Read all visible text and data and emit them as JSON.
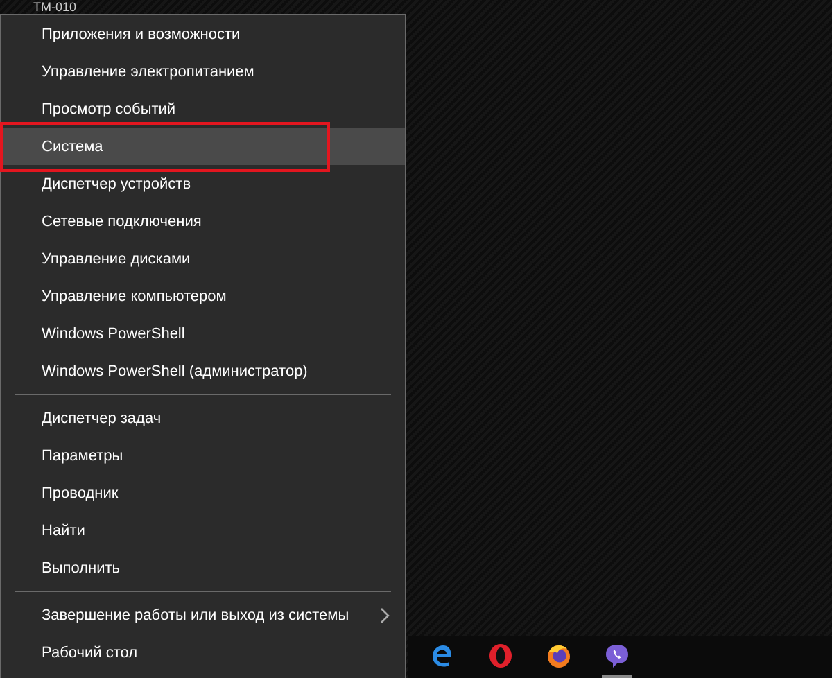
{
  "window_label": {
    "title": "TM-010"
  },
  "menu": {
    "sections": [
      {
        "items": [
          {
            "label": "Приложения и возможности",
            "selected": false,
            "highlighted": false,
            "submenu": false
          },
          {
            "label": "Управление электропитанием",
            "selected": false,
            "highlighted": false,
            "submenu": false
          },
          {
            "label": "Просмотр событий",
            "selected": false,
            "highlighted": false,
            "submenu": false
          },
          {
            "label": "Система",
            "selected": true,
            "highlighted": true,
            "submenu": false
          },
          {
            "label": "Диспетчер устройств",
            "selected": false,
            "highlighted": false,
            "submenu": false
          },
          {
            "label": "Сетевые подключения",
            "selected": false,
            "highlighted": false,
            "submenu": false
          },
          {
            "label": "Управление дисками",
            "selected": false,
            "highlighted": false,
            "submenu": false
          },
          {
            "label": "Управление компьютером",
            "selected": false,
            "highlighted": false,
            "submenu": false
          },
          {
            "label": "Windows PowerShell",
            "selected": false,
            "highlighted": false,
            "submenu": false
          },
          {
            "label": "Windows PowerShell (администратор)",
            "selected": false,
            "highlighted": false,
            "submenu": false
          }
        ]
      },
      {
        "items": [
          {
            "label": "Диспетчер задач",
            "selected": false,
            "highlighted": false,
            "submenu": false
          },
          {
            "label": "Параметры",
            "selected": false,
            "highlighted": false,
            "submenu": false
          },
          {
            "label": "Проводник",
            "selected": false,
            "highlighted": false,
            "submenu": false
          },
          {
            "label": "Найти",
            "selected": false,
            "highlighted": false,
            "submenu": false
          },
          {
            "label": "Выполнить",
            "selected": false,
            "highlighted": false,
            "submenu": false
          }
        ]
      },
      {
        "items": [
          {
            "label": "Завершение работы или выход из системы",
            "selected": false,
            "highlighted": false,
            "submenu": true
          },
          {
            "label": "Рабочий стол",
            "selected": false,
            "highlighted": false,
            "submenu": false
          }
        ]
      }
    ]
  },
  "taskbar": {
    "icons": [
      {
        "kind": "edge",
        "running": false
      },
      {
        "kind": "opera",
        "running": false
      },
      {
        "kind": "firefox",
        "running": false
      },
      {
        "kind": "viber",
        "running": true
      }
    ]
  }
}
